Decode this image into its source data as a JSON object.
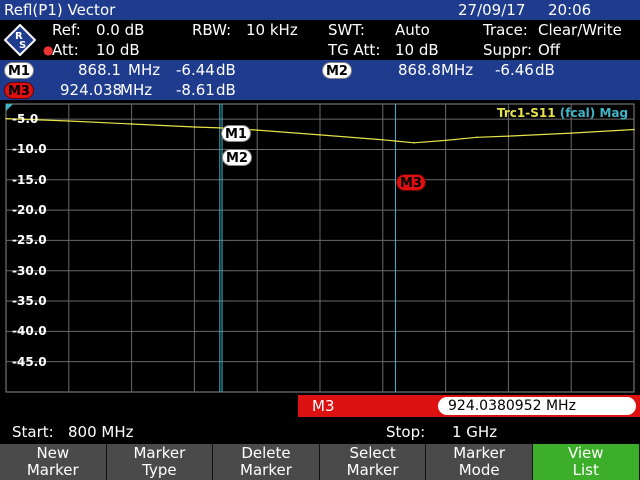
{
  "titlebar": {
    "title": "Refl(P1) Vector",
    "date": "27/09/17",
    "time": "20:06"
  },
  "settings": {
    "ref_label": "Ref:",
    "ref_value": "0.0 dB",
    "att_label": "Att:",
    "att_value": "10 dB",
    "rbw_label": "RBW:",
    "rbw_value": "10 kHz",
    "swt_label": "SWT:",
    "swt_value": "Auto",
    "tgatt_label": "TG Att:",
    "tgatt_value": "10 dB",
    "trace_label": "Trace:",
    "trace_value": "Clear/Write",
    "suppr_label": "Suppr:",
    "suppr_value": "Off"
  },
  "markers": [
    {
      "name": "M1",
      "freq": "868.1",
      "unit": "MHz",
      "level": "-6.44",
      "level_unit": "dB"
    },
    {
      "name": "M2",
      "freq": "868.8",
      "unit": "MHz",
      "level": "-6.46",
      "level_unit": "dB"
    },
    {
      "name": "M3",
      "freq": "924.038",
      "unit": "MHz",
      "level": "-8.61",
      "level_unit": "dB"
    }
  ],
  "trace_label": {
    "name": "Trc1-S11",
    "cal": "(fcal)",
    "format": "Mag"
  },
  "active_marker": {
    "name": "M3",
    "freq": "924.0380952 MHz"
  },
  "span": {
    "start_label": "Start:",
    "start_value": "800 MHz",
    "stop_label": "Stop:",
    "stop_value": "1 GHz"
  },
  "softkeys": [
    {
      "line1": "New",
      "line2": "Marker"
    },
    {
      "line1": "Marker",
      "line2": "Type"
    },
    {
      "line1": "Delete",
      "line2": "Marker"
    },
    {
      "line1": "Select",
      "line2": "Marker"
    },
    {
      "line1": "Marker",
      "line2": "Mode"
    },
    {
      "line1": "View",
      "line2": "List"
    }
  ],
  "chart_data": {
    "type": "line",
    "ylabel": "",
    "xlim": [
      800,
      1000
    ],
    "ylim": [
      -50,
      -2.5
    ],
    "yticks": [
      "-5.0",
      "-10.0",
      "-15.0",
      "-20.0",
      "-25.0",
      "-30.0",
      "-35.0",
      "-40.0",
      "-45.0"
    ],
    "grid": true,
    "series": [
      {
        "x": [
          800,
          820,
          840,
          860,
          868.1,
          868.8,
          880,
          900,
          920,
          924,
          930,
          940,
          950,
          960,
          980,
          1000
        ],
        "y": [
          -4.9,
          -5.3,
          -5.8,
          -6.3,
          -6.44,
          -6.46,
          -6.8,
          -7.6,
          -8.4,
          -8.61,
          -8.9,
          -8.5,
          -8.0,
          -7.8,
          -7.3,
          -6.7
        ]
      }
    ],
    "marker_lines_x": [
      868.1,
      868.8,
      924.038
    ]
  },
  "colors": {
    "header_bg": "#1f3b8e",
    "trace": "#e6e24a",
    "marker_line": "#3fb6c8",
    "active": "#3cae2a",
    "marker_red": "#dd1111"
  }
}
